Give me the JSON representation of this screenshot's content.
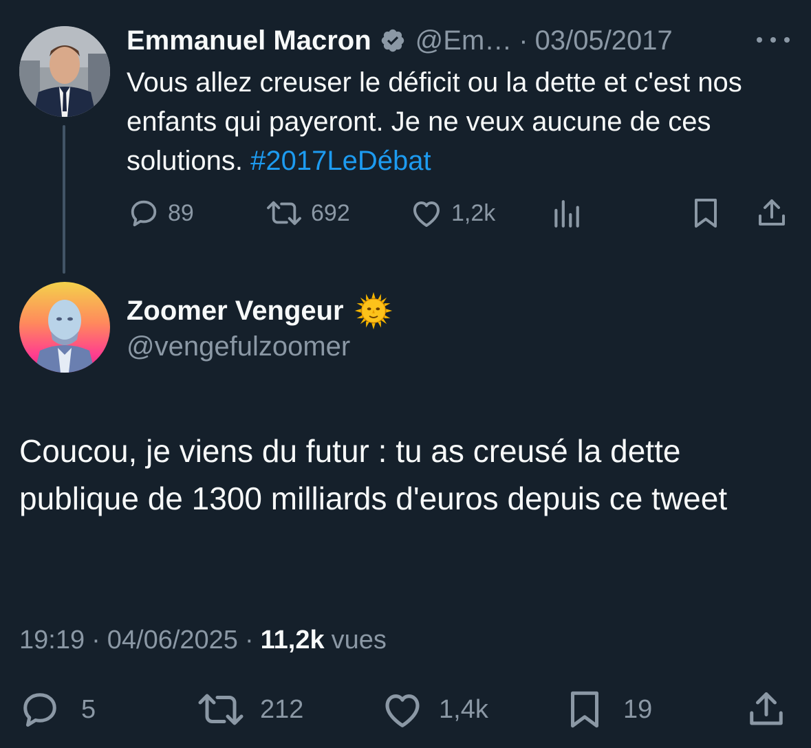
{
  "parent_tweet": {
    "display_name": "Emmanuel Macron",
    "handle": "@Em…",
    "separator": "·",
    "date": "03/05/2017",
    "text_main": "Vous allez creuser le déficit ou la dette et c'est nos enfants qui payeront. Je ne veux aucune de ces solutions. ",
    "hashtag": "#2017LeDébat",
    "actions": {
      "replies": "89",
      "retweets": "692",
      "likes": "1,2k"
    }
  },
  "reply_tweet": {
    "display_name": "Zoomer Vengeur",
    "handle": "@vengefulzoomer",
    "text": "Coucou, je viens du futur : tu as creusé la dette publique de 1300 milliards d'euros depuis ce tweet",
    "time": "19:19",
    "separator": "·",
    "date": "04/06/2025",
    "views_count": "11,2k",
    "views_label": "vues",
    "actions": {
      "replies": "5",
      "retweets": "212",
      "likes": "1,4k",
      "bookmarks": "19"
    }
  },
  "colors": {
    "background": "#15202b",
    "text_primary": "#f7f9f9",
    "text_secondary": "#8b98a5",
    "link": "#1d9bf0",
    "thread_line": "#425466"
  },
  "icons": {
    "verified": "verified-badge-icon",
    "more": "more-options-icon",
    "reply": "reply-bubble-icon",
    "retweet": "retweet-icon",
    "like": "heart-icon",
    "views": "analytics-bars-icon",
    "bookmark": "bookmark-icon",
    "share": "share-upload-icon",
    "emoji": "sun-with-face-icon"
  }
}
